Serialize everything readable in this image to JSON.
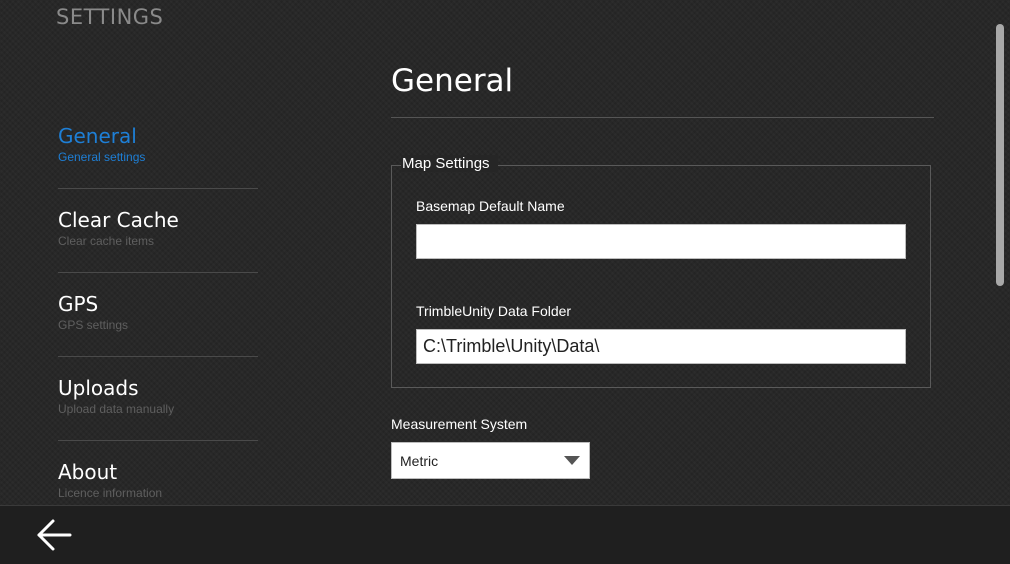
{
  "app": {
    "title": "SETTINGS"
  },
  "nav": {
    "items": [
      {
        "label": "General",
        "description": "General settings",
        "active": true
      },
      {
        "label": "Clear Cache",
        "description": "Clear cache items",
        "active": false
      },
      {
        "label": "GPS",
        "description": "GPS settings",
        "active": false
      },
      {
        "label": "Uploads",
        "description": "Upload data manually",
        "active": false
      },
      {
        "label": "About",
        "description": "Licence information",
        "active": false
      }
    ]
  },
  "page": {
    "title": "General"
  },
  "map_settings": {
    "legend": "Map Settings",
    "basemap_label": "Basemap Default Name",
    "basemap_value": "",
    "data_folder_label": "TrimbleUnity Data Folder",
    "data_folder_value": "C:\\Trimble\\Unity\\Data\\"
  },
  "measurement": {
    "label": "Measurement System",
    "selected": "Metric"
  },
  "bottom_bar": {
    "back_icon": "arrow-left-icon"
  },
  "colors": {
    "background": "#262626",
    "accent": "#1e7fd6",
    "muted_text": "#5f5f5f",
    "title_text": "#8a8a8a"
  }
}
